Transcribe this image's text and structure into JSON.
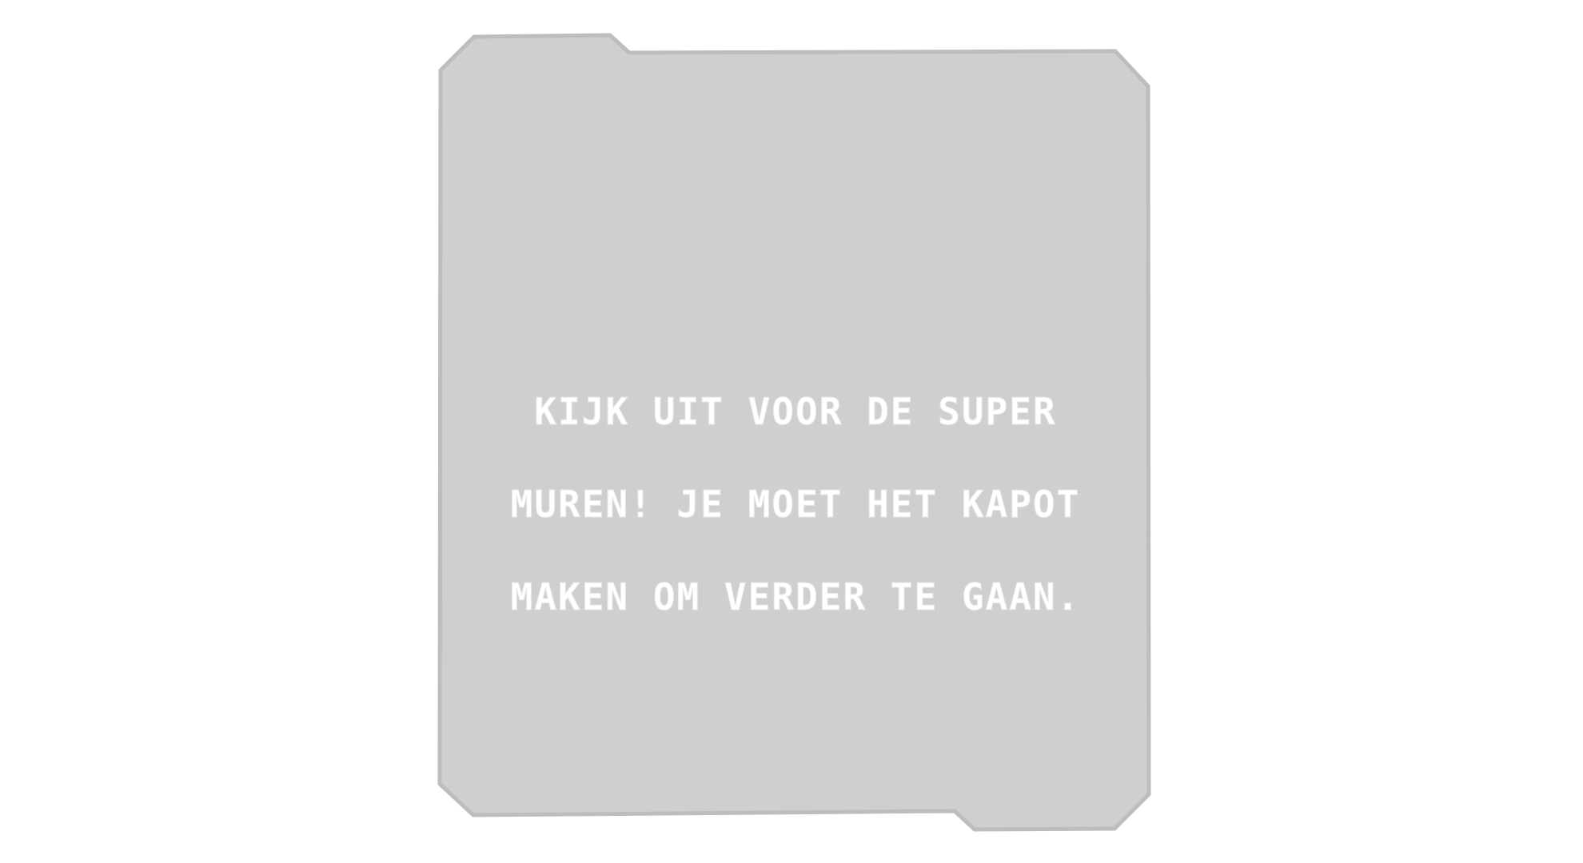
{
  "dialog": {
    "message_lines": [
      "KIJK UIT VOOR DE SUPER",
      "MUREN! JE MOET HET KAPOT",
      "MAKEN OM VERDER TE GAAN."
    ]
  },
  "colors": {
    "background": "#ffffff",
    "panel_fill": "#cfcfcf",
    "panel_border": "#bdbdbd",
    "text": "#ffffff"
  }
}
